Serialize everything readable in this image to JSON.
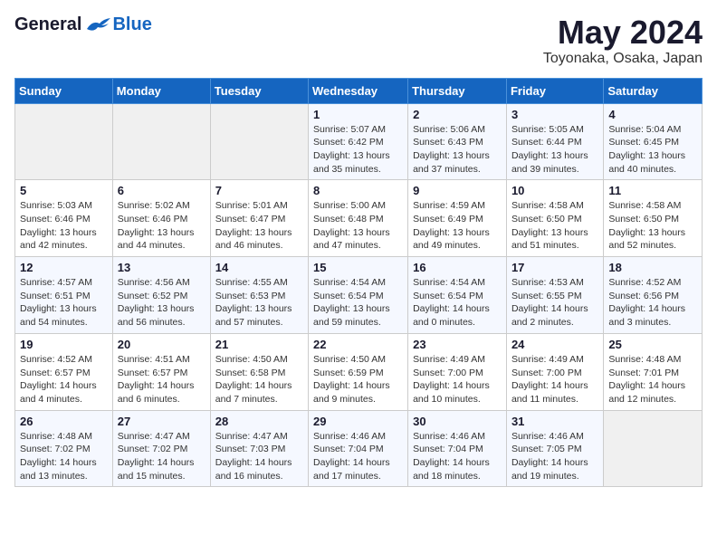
{
  "header": {
    "logo": {
      "general": "General",
      "blue": "Blue"
    },
    "title": "May 2024",
    "location": "Toyonaka, Osaka, Japan"
  },
  "weekdays": [
    "Sunday",
    "Monday",
    "Tuesday",
    "Wednesday",
    "Thursday",
    "Friday",
    "Saturday"
  ],
  "weeks": [
    [
      {
        "day": "",
        "info": ""
      },
      {
        "day": "",
        "info": ""
      },
      {
        "day": "",
        "info": ""
      },
      {
        "day": "1",
        "info": "Sunrise: 5:07 AM\nSunset: 6:42 PM\nDaylight: 13 hours\nand 35 minutes."
      },
      {
        "day": "2",
        "info": "Sunrise: 5:06 AM\nSunset: 6:43 PM\nDaylight: 13 hours\nand 37 minutes."
      },
      {
        "day": "3",
        "info": "Sunrise: 5:05 AM\nSunset: 6:44 PM\nDaylight: 13 hours\nand 39 minutes."
      },
      {
        "day": "4",
        "info": "Sunrise: 5:04 AM\nSunset: 6:45 PM\nDaylight: 13 hours\nand 40 minutes."
      }
    ],
    [
      {
        "day": "5",
        "info": "Sunrise: 5:03 AM\nSunset: 6:46 PM\nDaylight: 13 hours\nand 42 minutes."
      },
      {
        "day": "6",
        "info": "Sunrise: 5:02 AM\nSunset: 6:46 PM\nDaylight: 13 hours\nand 44 minutes."
      },
      {
        "day": "7",
        "info": "Sunrise: 5:01 AM\nSunset: 6:47 PM\nDaylight: 13 hours\nand 46 minutes."
      },
      {
        "day": "8",
        "info": "Sunrise: 5:00 AM\nSunset: 6:48 PM\nDaylight: 13 hours\nand 47 minutes."
      },
      {
        "day": "9",
        "info": "Sunrise: 4:59 AM\nSunset: 6:49 PM\nDaylight: 13 hours\nand 49 minutes."
      },
      {
        "day": "10",
        "info": "Sunrise: 4:58 AM\nSunset: 6:50 PM\nDaylight: 13 hours\nand 51 minutes."
      },
      {
        "day": "11",
        "info": "Sunrise: 4:58 AM\nSunset: 6:50 PM\nDaylight: 13 hours\nand 52 minutes."
      }
    ],
    [
      {
        "day": "12",
        "info": "Sunrise: 4:57 AM\nSunset: 6:51 PM\nDaylight: 13 hours\nand 54 minutes."
      },
      {
        "day": "13",
        "info": "Sunrise: 4:56 AM\nSunset: 6:52 PM\nDaylight: 13 hours\nand 56 minutes."
      },
      {
        "day": "14",
        "info": "Sunrise: 4:55 AM\nSunset: 6:53 PM\nDaylight: 13 hours\nand 57 minutes."
      },
      {
        "day": "15",
        "info": "Sunrise: 4:54 AM\nSunset: 6:54 PM\nDaylight: 13 hours\nand 59 minutes."
      },
      {
        "day": "16",
        "info": "Sunrise: 4:54 AM\nSunset: 6:54 PM\nDaylight: 14 hours\nand 0 minutes."
      },
      {
        "day": "17",
        "info": "Sunrise: 4:53 AM\nSunset: 6:55 PM\nDaylight: 14 hours\nand 2 minutes."
      },
      {
        "day": "18",
        "info": "Sunrise: 4:52 AM\nSunset: 6:56 PM\nDaylight: 14 hours\nand 3 minutes."
      }
    ],
    [
      {
        "day": "19",
        "info": "Sunrise: 4:52 AM\nSunset: 6:57 PM\nDaylight: 14 hours\nand 4 minutes."
      },
      {
        "day": "20",
        "info": "Sunrise: 4:51 AM\nSunset: 6:57 PM\nDaylight: 14 hours\nand 6 minutes."
      },
      {
        "day": "21",
        "info": "Sunrise: 4:50 AM\nSunset: 6:58 PM\nDaylight: 14 hours\nand 7 minutes."
      },
      {
        "day": "22",
        "info": "Sunrise: 4:50 AM\nSunset: 6:59 PM\nDaylight: 14 hours\nand 9 minutes."
      },
      {
        "day": "23",
        "info": "Sunrise: 4:49 AM\nSunset: 7:00 PM\nDaylight: 14 hours\nand 10 minutes."
      },
      {
        "day": "24",
        "info": "Sunrise: 4:49 AM\nSunset: 7:00 PM\nDaylight: 14 hours\nand 11 minutes."
      },
      {
        "day": "25",
        "info": "Sunrise: 4:48 AM\nSunset: 7:01 PM\nDaylight: 14 hours\nand 12 minutes."
      }
    ],
    [
      {
        "day": "26",
        "info": "Sunrise: 4:48 AM\nSunset: 7:02 PM\nDaylight: 14 hours\nand 13 minutes."
      },
      {
        "day": "27",
        "info": "Sunrise: 4:47 AM\nSunset: 7:02 PM\nDaylight: 14 hours\nand 15 minutes."
      },
      {
        "day": "28",
        "info": "Sunrise: 4:47 AM\nSunset: 7:03 PM\nDaylight: 14 hours\nand 16 minutes."
      },
      {
        "day": "29",
        "info": "Sunrise: 4:46 AM\nSunset: 7:04 PM\nDaylight: 14 hours\nand 17 minutes."
      },
      {
        "day": "30",
        "info": "Sunrise: 4:46 AM\nSunset: 7:04 PM\nDaylight: 14 hours\nand 18 minutes."
      },
      {
        "day": "31",
        "info": "Sunrise: 4:46 AM\nSunset: 7:05 PM\nDaylight: 14 hours\nand 19 minutes."
      },
      {
        "day": "",
        "info": ""
      }
    ]
  ]
}
